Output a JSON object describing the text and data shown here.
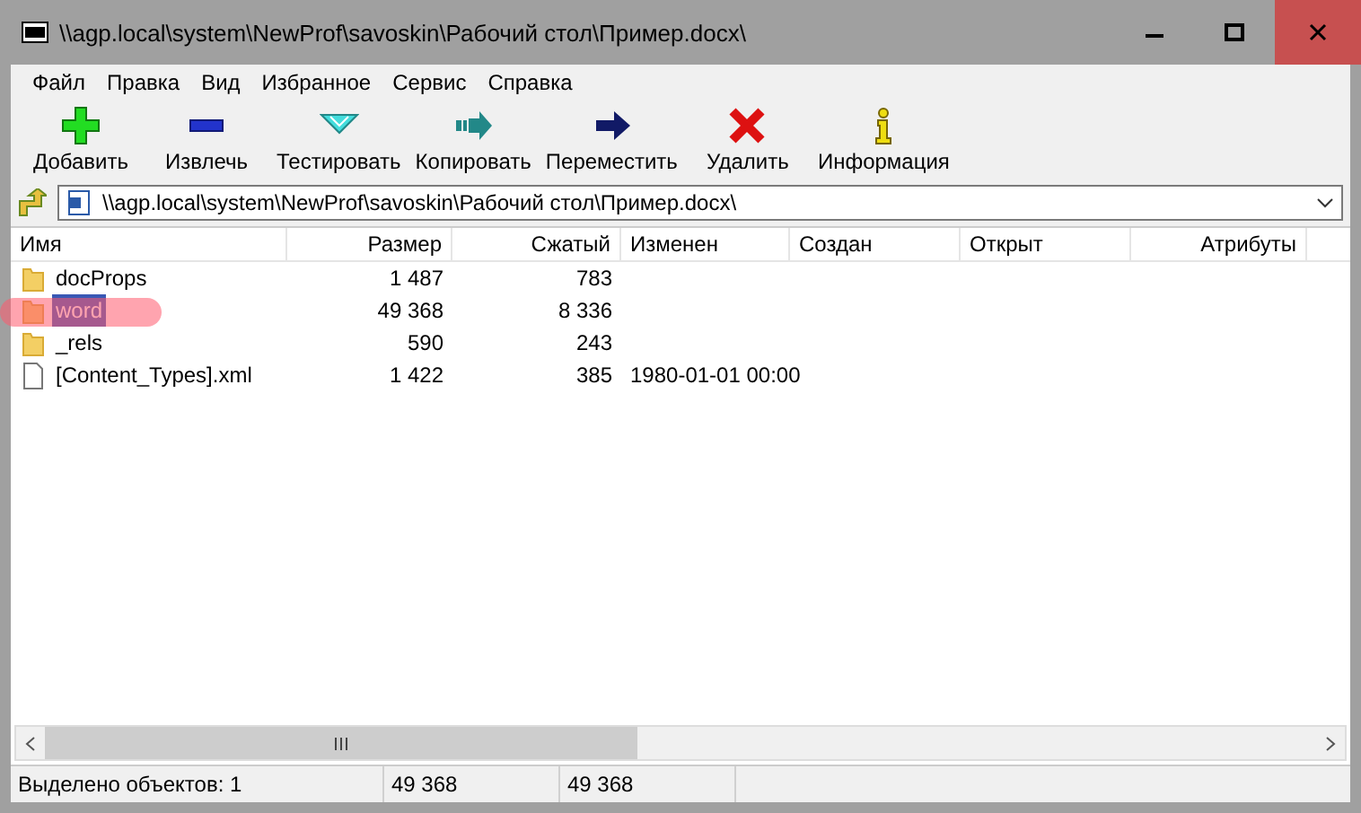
{
  "window": {
    "title": "\\\\agp.local\\system\\NewProf\\savoskin\\Рабочий стол\\Пример.docx\\"
  },
  "menu": [
    "Файл",
    "Правка",
    "Вид",
    "Избранное",
    "Сервис",
    "Справка"
  ],
  "toolbar": [
    {
      "kind": "add",
      "label": "Добавить"
    },
    {
      "kind": "extract",
      "label": "Извлечь"
    },
    {
      "kind": "test",
      "label": "Тестировать"
    },
    {
      "kind": "copy",
      "label": "Копировать"
    },
    {
      "kind": "move",
      "label": "Переместить"
    },
    {
      "kind": "delete",
      "label": "Удалить"
    },
    {
      "kind": "info",
      "label": "Информация"
    }
  ],
  "address": {
    "value": "\\\\agp.local\\system\\NewProf\\savoskin\\Рабочий стол\\Пример.docx\\"
  },
  "table": {
    "columns": [
      "Имя",
      "Размер",
      "Сжатый",
      "Изменен",
      "Создан",
      "Открыт",
      "Атрибуты"
    ],
    "rows": [
      {
        "kind": "folder",
        "name": "docProps",
        "size": "1 487",
        "packed": "783",
        "selected": false,
        "marked": false
      },
      {
        "kind": "folder",
        "name": "word",
        "size": "49 368",
        "packed": "8 336",
        "selected": true,
        "marked": true
      },
      {
        "kind": "folder",
        "name": "_rels",
        "size": "590",
        "packed": "243",
        "selected": false,
        "marked": false
      },
      {
        "kind": "file",
        "name": "[Content_Types].xml",
        "size": "1 422",
        "packed": "385",
        "modified": "1980-01-01 00:00",
        "selected": false,
        "marked": false
      }
    ]
  },
  "status_bar": [
    "Выделено объектов: 1",
    "49 368",
    "49 368"
  ]
}
